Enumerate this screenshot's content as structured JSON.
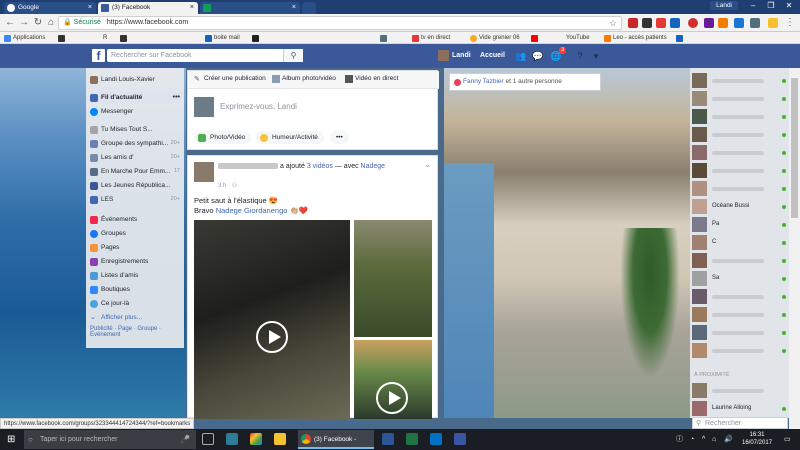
{
  "browser": {
    "tabs": [
      {
        "label": "Google"
      },
      {
        "label": "(3) Facebook"
      },
      {
        "label": ""
      }
    ],
    "window_user": "Landi",
    "secure_label": "Sécurisé",
    "url": "https://www.facebook.com",
    "bookmarks": [
      "Applications",
      "R",
      "boite mail",
      "tv en direct",
      "Vide grenier 06",
      "YouTube",
      "Leo - accès patients"
    ],
    "status_url": "https://www.facebook.com/groups/323344414724344/?ref=bookmarks"
  },
  "fb": {
    "search_placeholder": "Rechercher sur Facebook",
    "user": "Landi",
    "home": "Accueil",
    "notification_badge": "3"
  },
  "leftnav": {
    "profile": "Landi Louis-Xavier",
    "items": [
      {
        "label": "Fil d'actualité",
        "more": "•••"
      },
      {
        "label": "Messenger"
      },
      {
        "label": "Tu Mises Tout S...",
        "count": ""
      },
      {
        "label": "Groupe des sympathi...",
        "count": "20+"
      },
      {
        "label": "Les amis d'",
        "count": "20+"
      },
      {
        "label": "En Marche Pour Emm...",
        "count": "17"
      },
      {
        "label": "Les Jeunes Républica...",
        "count": ""
      },
      {
        "label": "LES",
        "count": "20+"
      },
      {
        "label": "Événements"
      },
      {
        "label": "Groupes"
      },
      {
        "label": "Pages"
      },
      {
        "label": "Enregistrements"
      },
      {
        "label": "Listes d'amis"
      },
      {
        "label": "Boutiques"
      },
      {
        "label": "Ce jour-là"
      },
      {
        "label": "Afficher plus..."
      }
    ],
    "footer": "Publicité · Page · Groupe · Événement"
  },
  "composer": {
    "tabs": [
      "Créer une publication",
      "Album photo/vidéo",
      "Vidéo en direct"
    ],
    "placeholder": "Exprimez-vous, Landi",
    "buttons": [
      "Photo/Vidéo",
      "Humeur/Activité",
      "•••"
    ]
  },
  "post": {
    "action": "a ajouté",
    "videos_link": "3 vidéos",
    "with": "— avec",
    "tagged": "Nadege",
    "time": "3 h",
    "line1": "Petit saut à l'élastique 😍",
    "line2_prefix": "Bravo",
    "line2_name": "Nadege Giordanengo",
    "line2_suffix": "👏🏼❤️"
  },
  "notification": {
    "name": "Fanny Tazbier",
    "rest": "et 1 autre personne"
  },
  "chat": {
    "names": [
      "Océane Bussi",
      "Pa",
      "C",
      "Sa"
    ],
    "proximity_label": "À PROXIMITÉ",
    "last_contact": "Laurine Alloing",
    "search_placeholder": "Rechercher"
  },
  "taskbar": {
    "search_placeholder": "Taper ici pour rechercher",
    "active_app": "(3) Facebook - Goo...",
    "time": "16:31",
    "date": "16/07/2017"
  }
}
